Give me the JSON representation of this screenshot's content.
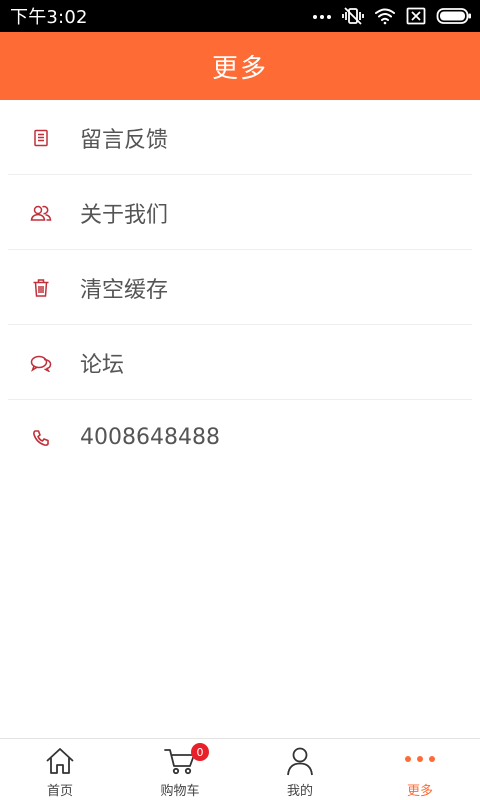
{
  "status_bar": {
    "time": "下午3:02"
  },
  "header": {
    "title": "更多"
  },
  "menu": {
    "items": [
      {
        "label": "留言反馈",
        "icon": "document-icon"
      },
      {
        "label": "关于我们",
        "icon": "users-icon"
      },
      {
        "label": "清空缓存",
        "icon": "trash-icon"
      },
      {
        "label": "论坛",
        "icon": "chat-bubbles-icon"
      },
      {
        "label": "4008648488",
        "icon": "phone-icon"
      }
    ]
  },
  "tabbar": {
    "tabs": [
      {
        "label": "首页",
        "icon": "home-icon",
        "active": false
      },
      {
        "label": "购物车",
        "icon": "cart-icon",
        "active": false,
        "badge": "0"
      },
      {
        "label": "我的",
        "icon": "user-icon",
        "active": false
      },
      {
        "label": "更多",
        "icon": "more-dots-icon",
        "active": true
      }
    ]
  },
  "colors": {
    "accent": "#ff6b35",
    "icon": "#c0303a",
    "badge": "#e8202a"
  }
}
